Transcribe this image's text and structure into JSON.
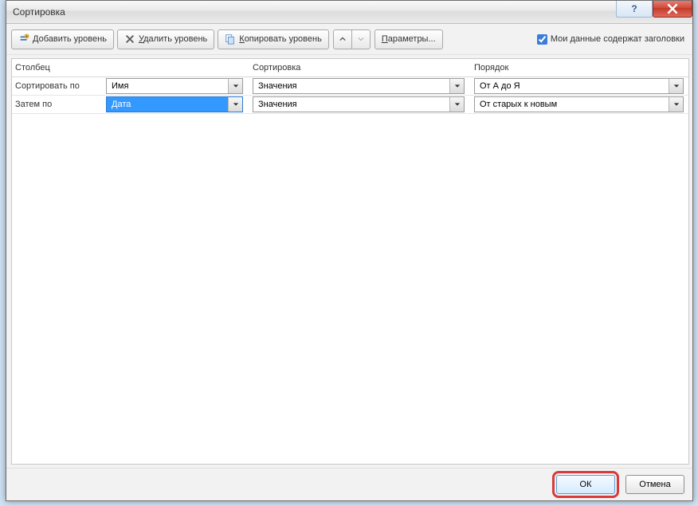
{
  "window": {
    "title": "Сортировка"
  },
  "toolbar": {
    "add_level": "Добавить уровень",
    "delete_level": "Удалить уровень",
    "copy_level": "Копировать уровень",
    "options": "Параметры...",
    "headers_label": "Мои данные содержат заголовки",
    "headers_checked": true
  },
  "headers": {
    "column": "Столбец",
    "sort_on": "Сортировка",
    "order": "Порядок"
  },
  "rows": [
    {
      "label": "Сортировать по",
      "column_value": "Имя",
      "sorton_value": "Значения",
      "order_value": "От А до Я",
      "selected": false
    },
    {
      "label": "Затем по",
      "column_value": "Дата",
      "sorton_value": "Значения",
      "order_value": "От старых к новым",
      "selected": true
    }
  ],
  "footer": {
    "ok": "ОК",
    "cancel": "Отмена"
  }
}
